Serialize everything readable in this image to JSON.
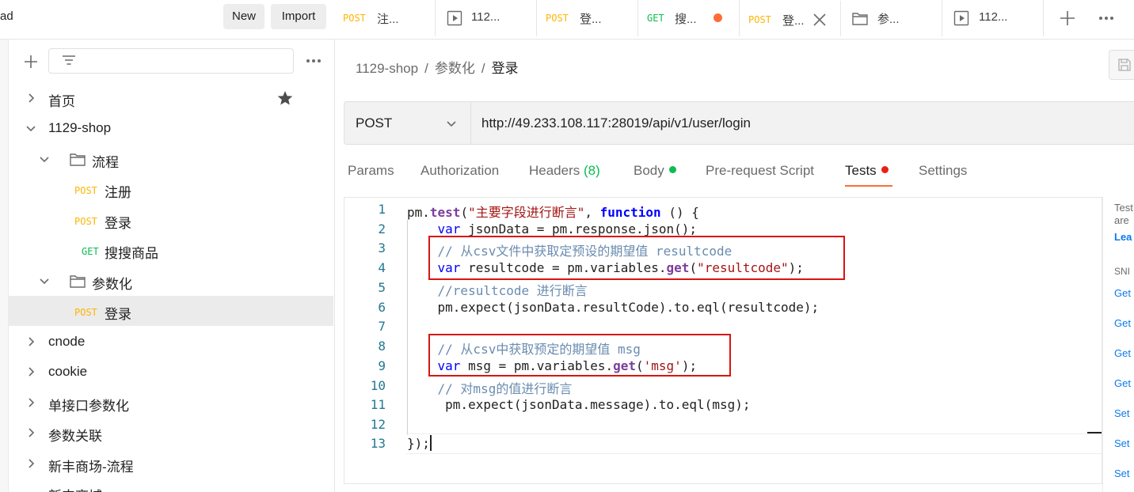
{
  "sidebar": {
    "workspace_title": "ad",
    "new_label": "New",
    "import_label": "Import",
    "tree": [
      {
        "label": "首页"
      },
      {
        "label": "1129-shop"
      },
      {
        "label": "流程"
      },
      {
        "method": "POST",
        "label": "注册"
      },
      {
        "method": "POST",
        "label": "登录"
      },
      {
        "method": "GET",
        "label": "搜搜商品"
      },
      {
        "label": "参数化"
      },
      {
        "method": "POST",
        "label": "登录"
      },
      {
        "label": "cnode"
      },
      {
        "label": "cookie"
      },
      {
        "label": "单接口参数化"
      },
      {
        "label": "参数关联"
      },
      {
        "label": "新丰商场-流程"
      },
      {
        "label": "新丰商城"
      }
    ]
  },
  "tabs": [
    {
      "method": "POST",
      "name": "注..."
    },
    {
      "name": "112..."
    },
    {
      "method": "POST",
      "name": "登..."
    },
    {
      "method": "GET",
      "name": "搜..."
    },
    {
      "method": "POST",
      "name": "登..."
    },
    {
      "name": "参..."
    },
    {
      "name": "112..."
    }
  ],
  "breadcrumb": {
    "collection": "1129-shop",
    "folder": "参数化",
    "request": "登录",
    "separator": "/"
  },
  "request": {
    "method": "POST",
    "url": "http://49.233.108.117:28019/api/v1/user/login"
  },
  "request_tabs": {
    "params": "Params",
    "authorization": "Authorization",
    "headers": "Headers",
    "headers_count": "(8)",
    "body": "Body",
    "pre_request": "Pre-request Script",
    "tests": "Tests",
    "settings": "Settings"
  },
  "editor": {
    "line_numbers": [
      "1",
      "2",
      "3",
      "4",
      "5",
      "6",
      "7",
      "8",
      "9",
      "10",
      "11",
      "12",
      "13"
    ],
    "l1": {
      "a": "pm.",
      "b": "test",
      "c": "(",
      "d": "\"主要字段进行断言\"",
      "e": ", ",
      "f": "function",
      "g": " () {"
    },
    "l2": {
      "a": "    ",
      "b": "var",
      "c": " jsonData = pm.response.json();"
    },
    "l3": "    // 从csv文件中获取定预设的期望值 resultcode",
    "l4": {
      "a": "    ",
      "b": "var",
      "c": " resultcode = pm.variables.",
      "d": "get",
      "e": "(",
      "f": "\"resultcode\"",
      "g": ");"
    },
    "l5": "    //resultcode 进行断言",
    "l6": "    pm.expect(jsonData.resultCode).to.eql(resultcode);",
    "l8": "    // 从csv中获取预定的期望值 msg",
    "l9": {
      "a": "    ",
      "b": "var",
      "c": " msg = pm.variables.",
      "d": "get",
      "e": "(",
      "f": "'msg'",
      "g": ");"
    },
    "l10": "    // 对msg的值进行断言",
    "l11": "     pm.expect(jsonData.message).to.eql(msg);",
    "l13": "});"
  },
  "right_panel": {
    "lines": [
      "Test",
      "are",
      "Lea",
      "SNI",
      "Get",
      "Get",
      "Get",
      "Get",
      "Set",
      "Set",
      "Set"
    ]
  },
  "colors": {
    "post": "#ffb400",
    "get": "#0cbb52",
    "accent": "#ff6c37",
    "unsaved_dot": "#ff6c37",
    "body_dot": "#0cbb52",
    "tests_dot": "#eb2013",
    "highlight_box": "#d9140f"
  }
}
